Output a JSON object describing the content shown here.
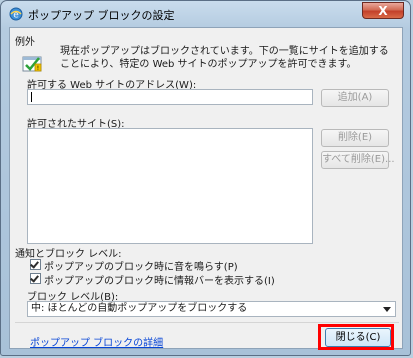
{
  "window": {
    "title": "ポップアップ ブロックの設定",
    "close_glyph": "X"
  },
  "exceptions": {
    "section_label": "例外",
    "description": "現在ポップアップはブロックされています。下の一覧にサイトを追加することにより、特定の Web サイトのポップアップを許可できます。",
    "address_label": "許可する Web サイトのアドレス(W):",
    "address_value": "",
    "add_button": "追加(A)",
    "allowed_label": "許可されたサイト(S):",
    "allowed_sites": [],
    "remove_button": "削除(E)",
    "remove_all_button": "すべて削除(E)..."
  },
  "notifications": {
    "section_label": "通知とブロック レベル:",
    "options": [
      {
        "label": "ポップアップのブロック時に音を鳴らす(P)",
        "checked": true
      },
      {
        "label": "ポップアップのブロック時に情報バーを表示する(I)",
        "checked": true
      }
    ],
    "block_level_label": "ブロック レベル(B):",
    "block_level_value": "中: ほとんどの自動ポップアップをブロックする"
  },
  "footer": {
    "details_link": "ポップアップ ブロックの詳細",
    "close_button": "閉じる(C)"
  },
  "colors": {
    "highlight": "#ff0000",
    "link": "#0645d6"
  }
}
